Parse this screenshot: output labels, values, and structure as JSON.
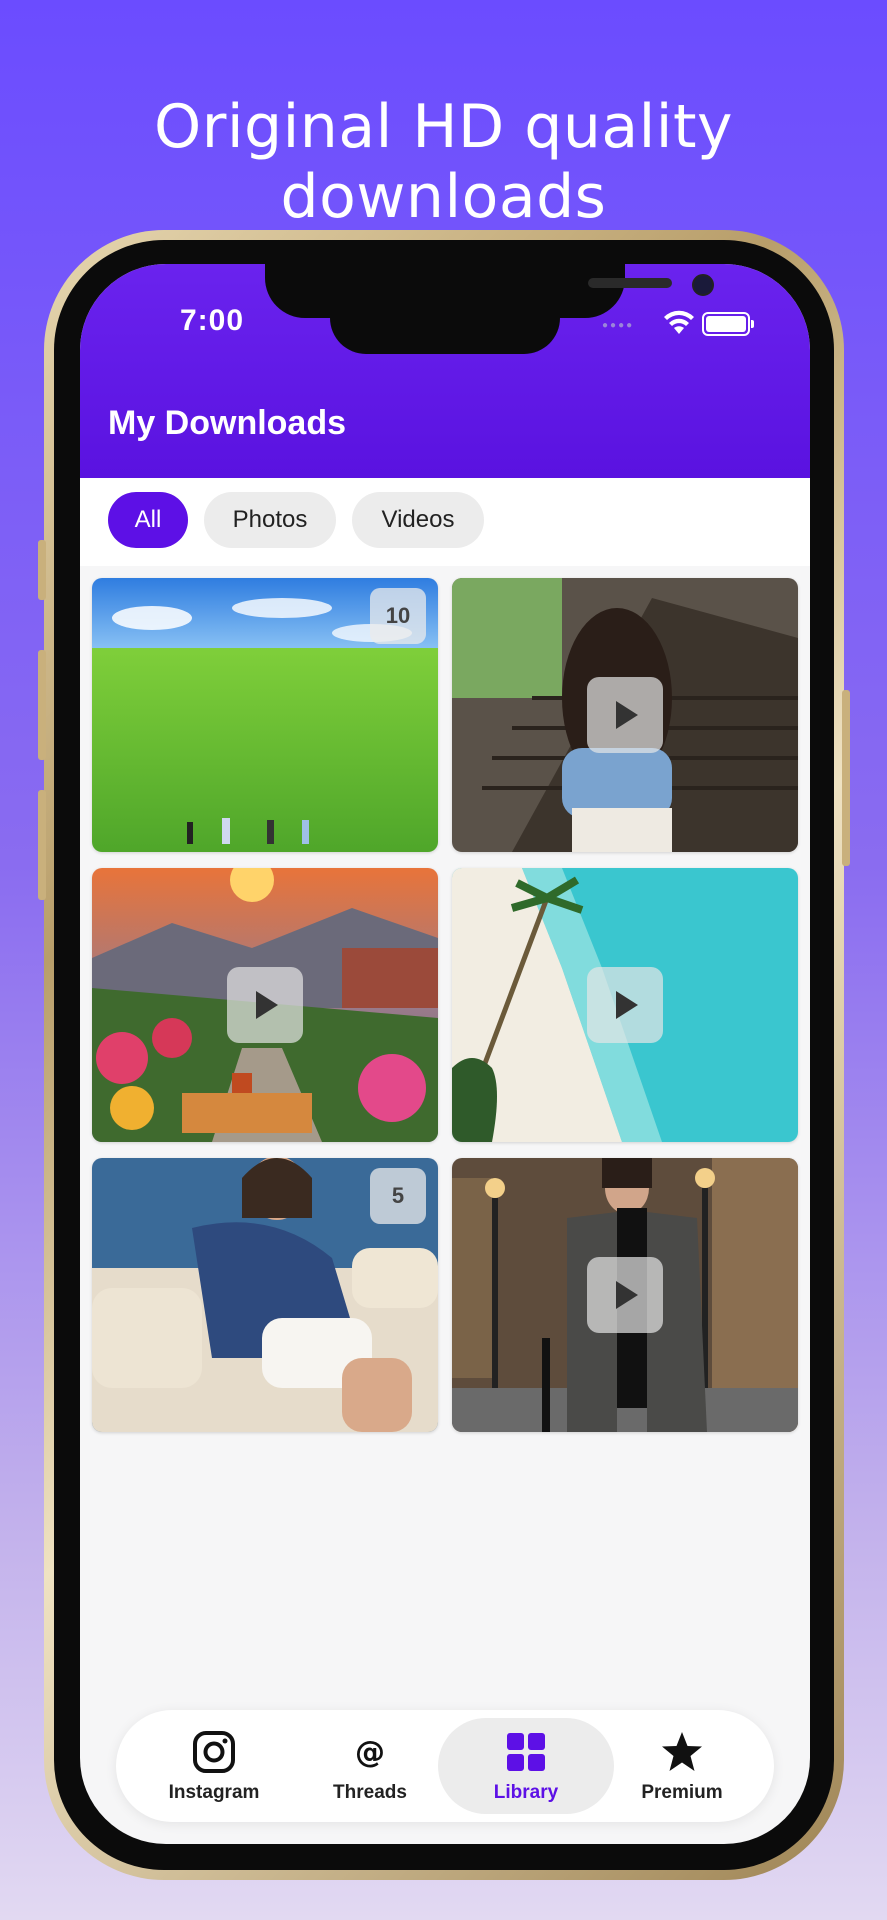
{
  "headline": "Original HD quality downloads",
  "status_bar": {
    "time": "7:00"
  },
  "header": {
    "title": "My Downloads"
  },
  "filters": [
    {
      "label": "All",
      "active": true
    },
    {
      "label": "Photos",
      "active": false
    },
    {
      "label": "Videos",
      "active": false
    }
  ],
  "items": [
    {
      "type": "photo-album",
      "count": "10",
      "subject": "green meadow with people"
    },
    {
      "type": "video",
      "subject": "woman on stairs"
    },
    {
      "type": "video",
      "subject": "sunset garden"
    },
    {
      "type": "video",
      "subject": "tropical beach"
    },
    {
      "type": "photo-album",
      "count": "5",
      "subject": "woman on boat"
    },
    {
      "type": "video",
      "subject": "woman in trench coat"
    }
  ],
  "tabbar": {
    "tabs": [
      {
        "label": "Instagram",
        "icon": "instagram-icon"
      },
      {
        "label": "Threads",
        "icon": "threads-icon"
      },
      {
        "label": "Library",
        "icon": "library-grid-icon",
        "active": true
      },
      {
        "label": "Premium",
        "icon": "star-icon"
      }
    ]
  },
  "colors": {
    "accent": "#5d10e6",
    "background_top": "#6b4cff",
    "header": "#6a23ee"
  }
}
